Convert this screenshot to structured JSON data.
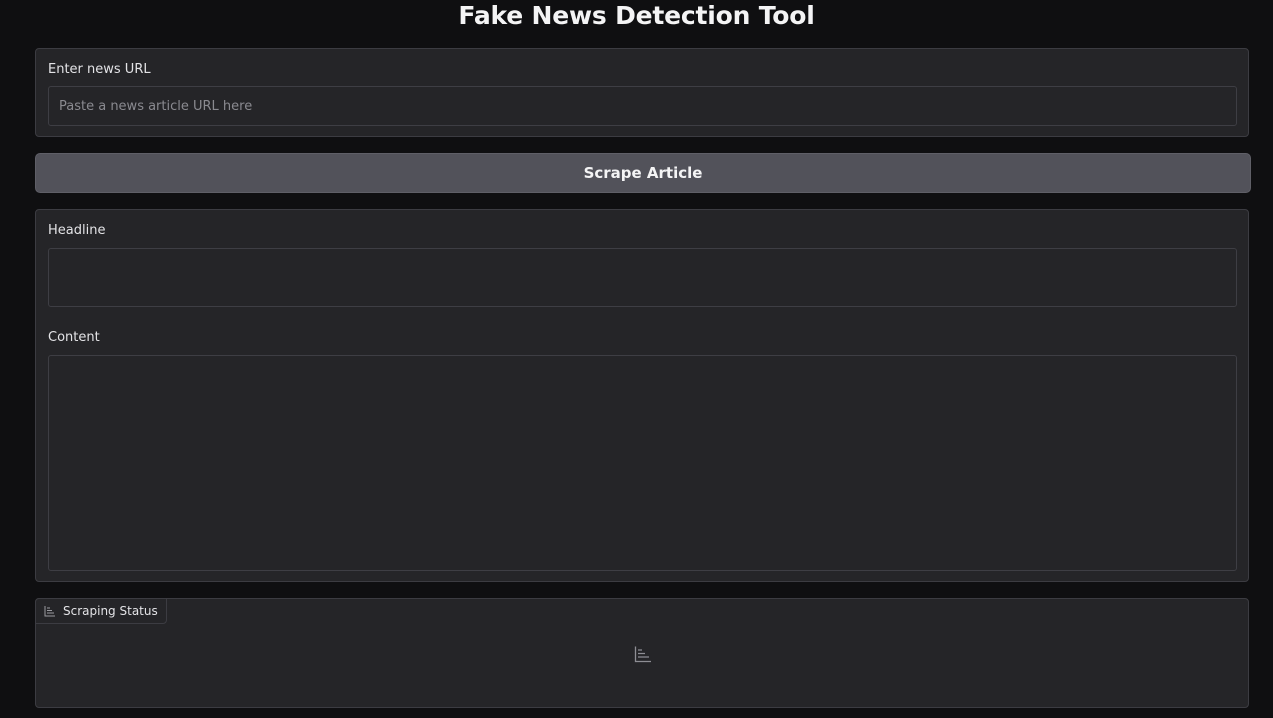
{
  "app": {
    "title": "Fake News Detection Tool"
  },
  "url_section": {
    "label": "Enter news URL",
    "value": "",
    "placeholder": "Paste a news article URL here"
  },
  "scrape_button": {
    "label": "Scrape Article"
  },
  "article": {
    "headline_label": "Headline",
    "headline_value": "",
    "content_label": "Content",
    "content_value": ""
  },
  "status": {
    "tab_label": "Scraping Status",
    "tab_icon": "bar-chart-icon",
    "placeholder_icon": "bar-chart-icon"
  }
}
